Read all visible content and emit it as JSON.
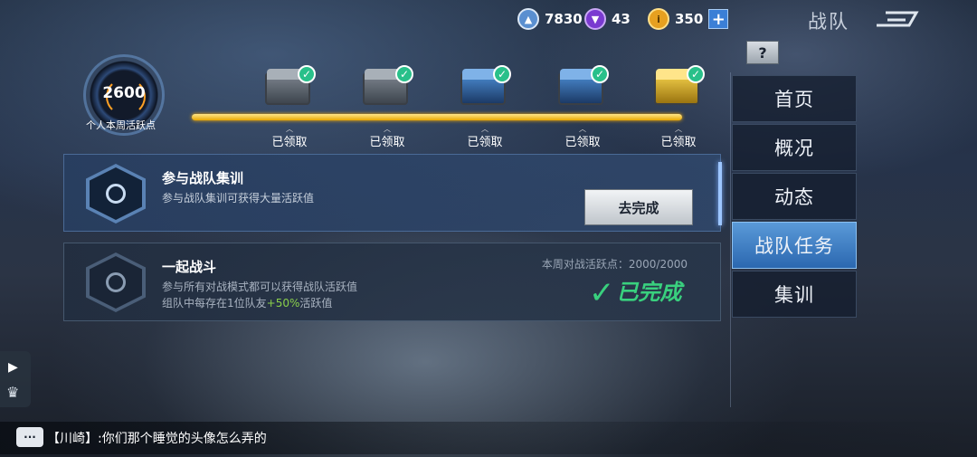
{
  "topbar": {
    "currency1": "7830",
    "currency2": "43",
    "currency3": "350",
    "page_title": "战队",
    "help_label": "?"
  },
  "activity": {
    "value": "2600",
    "label": "个人本周活跃点",
    "progress": 1.0,
    "chests": [
      {
        "status": "已领取",
        "color": "silver"
      },
      {
        "status": "已领取",
        "color": "silver"
      },
      {
        "status": "已领取",
        "color": "blue"
      },
      {
        "status": "已领取",
        "color": "blue"
      },
      {
        "status": "已领取",
        "color": "gold"
      }
    ]
  },
  "tasks": [
    {
      "title": "参与战队集训",
      "desc1": "参与战队集训可获得大量活跃值",
      "button": "去完成"
    },
    {
      "title": "一起战斗",
      "week_label": "本周对战活跃点：2000/2000",
      "desc1": "参与所有对战模式都可以获得战队活跃值",
      "desc2_prefix": "组队中每存在1位队友",
      "desc2_bonus": "+50%",
      "desc2_suffix": "活跃值",
      "done_label": "已完成"
    }
  ],
  "nav": {
    "items": [
      "首页",
      "概况",
      "动态",
      "战队任务",
      "集训"
    ],
    "active_index": 3
  },
  "chat": {
    "icon": "···",
    "message": "【川崎】:你们那个睡觉的头像怎么弄的"
  },
  "colors": {
    "accent": "#2b68b0",
    "progress": "#e8a800",
    "done": "#39d07e"
  }
}
